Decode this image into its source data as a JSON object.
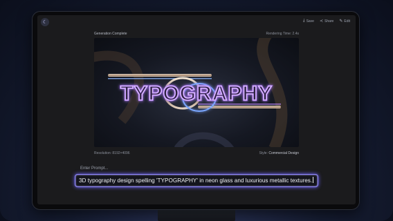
{
  "app": {
    "logo_glyph": "☾",
    "logo_icon": "moon-icon"
  },
  "toolbar": {
    "save_label": "Save",
    "share_label": "Share",
    "edit_label": "Edit"
  },
  "status": {
    "left": "Generation Complete",
    "right": "Rendering Time: 2.4s"
  },
  "artwork": {
    "word": "TYPOGRAPHY"
  },
  "meta": {
    "resolution": "Resolution: 8192×4096",
    "style_label": "Style: ",
    "style_value": "Commercial Design"
  },
  "prompt": {
    "label": "Enter Prompt...",
    "value": "3D typography design spelling 'TYPOGRAPHY' in neon glass and luxurious metallic textures."
  },
  "colors": {
    "accent": "#8f86ff",
    "glow": "#b07cff"
  }
}
